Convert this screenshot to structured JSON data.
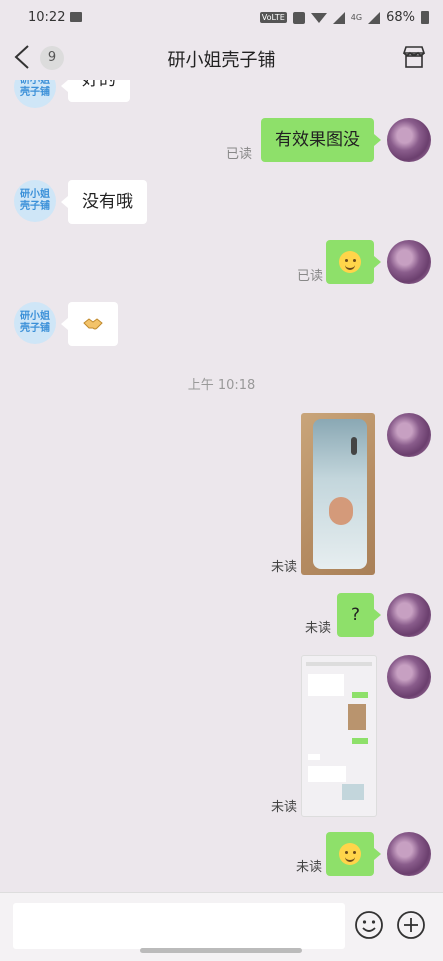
{
  "statusbar": {
    "time": "10:22",
    "volte": "VoLTE",
    "network": "4G",
    "battery": "68%"
  },
  "header": {
    "unread_count": "9",
    "title": "研小姐壳子铺"
  },
  "shop_avatar_text": "研小姐\n壳子铺",
  "messages": {
    "m0_text": "好的",
    "m1_text": "有效果图没",
    "m1_status": "已读",
    "m2_text": "没有哦",
    "m3_status": "已读",
    "timestamp": "上午 10:18",
    "m5_status": "未读",
    "m6_text": "?",
    "m6_status": "未读",
    "m7_status": "未读",
    "m8_status": "未读"
  },
  "input": {
    "placeholder": ""
  },
  "icons": {
    "back": "chevron-left-icon",
    "shop": "store-icon",
    "emoji": "smile-icon",
    "more": "plus-icon"
  }
}
